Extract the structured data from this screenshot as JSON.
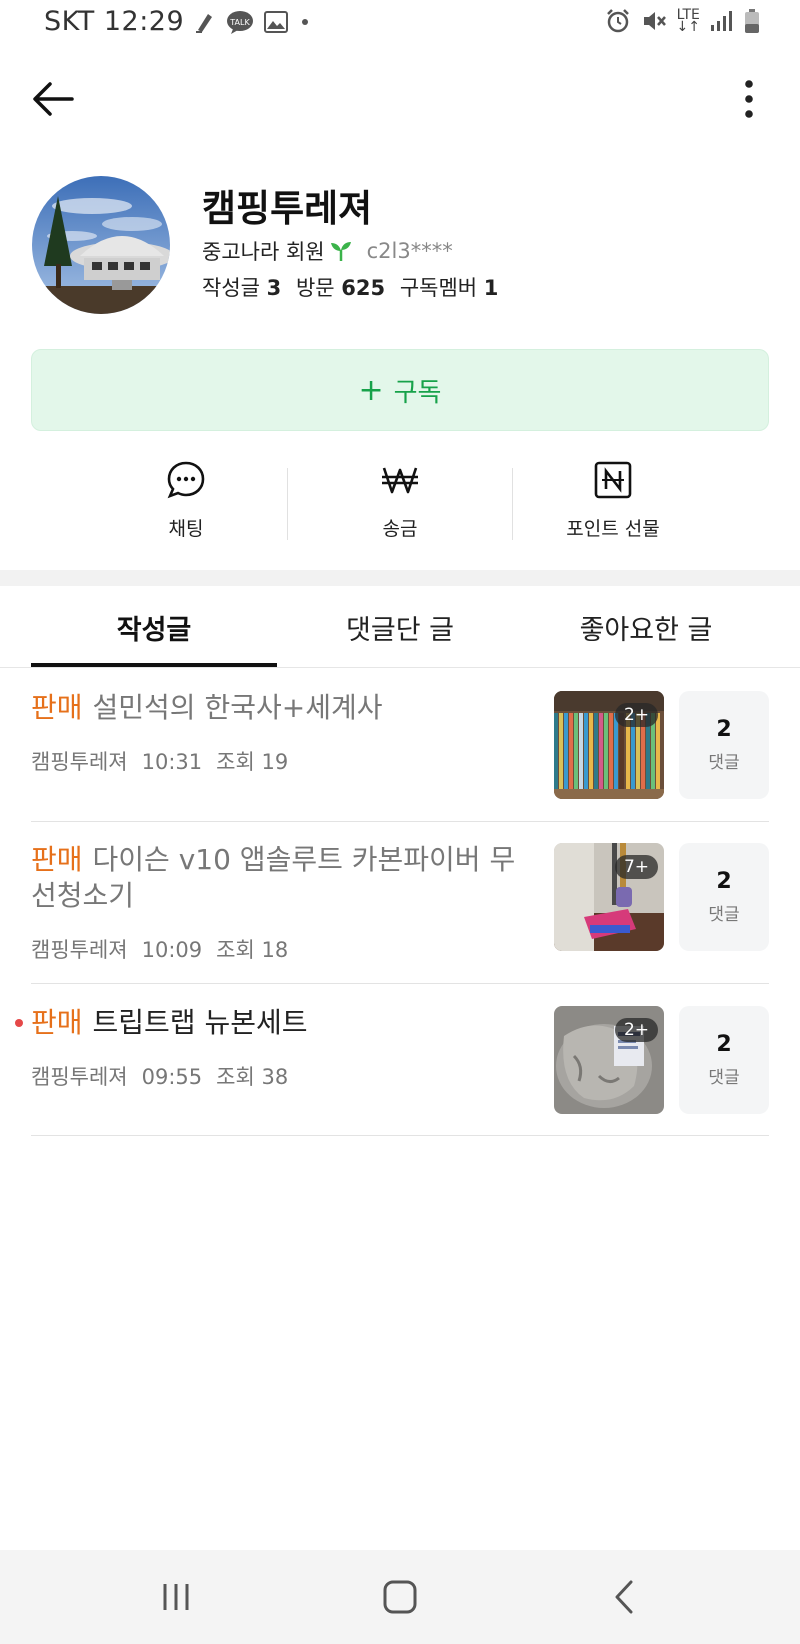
{
  "status_bar": {
    "carrier": "SKT",
    "time": "12:29",
    "network": "LTE",
    "icons": [
      "pen-icon",
      "talk-icon",
      "image-icon",
      "dot-icon",
      "alarm-icon",
      "mute-icon",
      "lte-icon",
      "signal-icon",
      "battery-icon"
    ]
  },
  "header": {
    "back_icon": "arrow-left-icon",
    "more_icon": "more-vertical-icon"
  },
  "profile": {
    "name": "캠핑투레져",
    "member_level": "중고나라 회원",
    "user_id": "c2l3****",
    "stats": [
      {
        "label": "작성글",
        "value": "3"
      },
      {
        "label": "방문",
        "value": "625"
      },
      {
        "label": "구독멤버",
        "value": "1"
      }
    ]
  },
  "subscribe": {
    "plus": "+",
    "label": "구독",
    "color": "#17a24a"
  },
  "actions": [
    {
      "label": "채팅",
      "icon": "chat-icon"
    },
    {
      "label": "송금",
      "icon": "won-icon"
    },
    {
      "label": "포인트 선물",
      "icon": "point-n-icon"
    }
  ],
  "tabs": [
    {
      "label": "작성글",
      "active": true
    },
    {
      "label": "댓글단 글",
      "active": false
    },
    {
      "label": "좋아요한 글",
      "active": false
    }
  ],
  "posts": [
    {
      "tag": "판매",
      "title": "설민석의 한국사+세계사",
      "author": "캠핑투레져",
      "time": "10:31",
      "views": "조회 19",
      "image_count": "2+",
      "comments": "2",
      "comment_label": "댓글",
      "read": true
    },
    {
      "tag": "판매",
      "title": "다이슨 v10 앱솔루트 카본파이버 무선청소기",
      "author": "캠핑투레져",
      "time": "10:09",
      "views": "조회 18",
      "image_count": "7+",
      "comments": "2",
      "comment_label": "댓글",
      "read": true
    },
    {
      "tag": "판매",
      "title": "트립트랩 뉴본세트",
      "author": "캠핑투레져",
      "time": "09:55",
      "views": "조회 38",
      "image_count": "2+",
      "comments": "2",
      "comment_label": "댓글",
      "read": false
    }
  ],
  "colors": {
    "tag": "#e6701a",
    "accent_green": "#17a24a",
    "subscribe_bg": "#e3f7ea"
  },
  "nav_bar": {
    "icons": [
      "recent-apps-icon",
      "home-icon",
      "back-icon"
    ]
  }
}
